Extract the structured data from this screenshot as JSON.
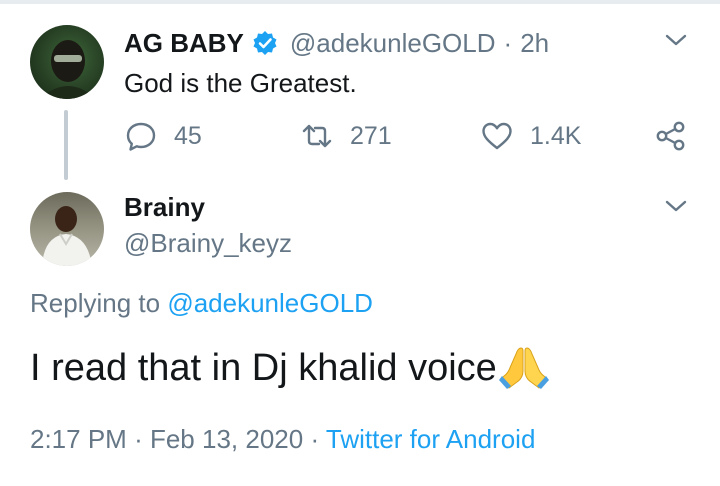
{
  "parent_tweet": {
    "display_name": "AG BABY",
    "handle": "@adekunleGOLD",
    "separator": "·",
    "time": "2h",
    "text": "God is the Greatest.",
    "reply_count": "45",
    "retweet_count": "271",
    "like_count": "1.4K",
    "verified": true
  },
  "reply_tweet": {
    "display_name": "Brainy",
    "handle": "@Brainy_keyz",
    "replying_prefix": "Replying to",
    "replying_to": "@adekunleGOLD",
    "text": "I read that in Dj khalid voice",
    "emoji": "folded-hands",
    "time": "2:17 PM",
    "separator": "·",
    "date": "Feb 13, 2020",
    "separator2": "·",
    "source": "Twitter for Android"
  },
  "colors": {
    "text": "#14171a",
    "secondary": "#657786",
    "accent": "#1da1f2",
    "thread_line": "#c4ccd3"
  }
}
